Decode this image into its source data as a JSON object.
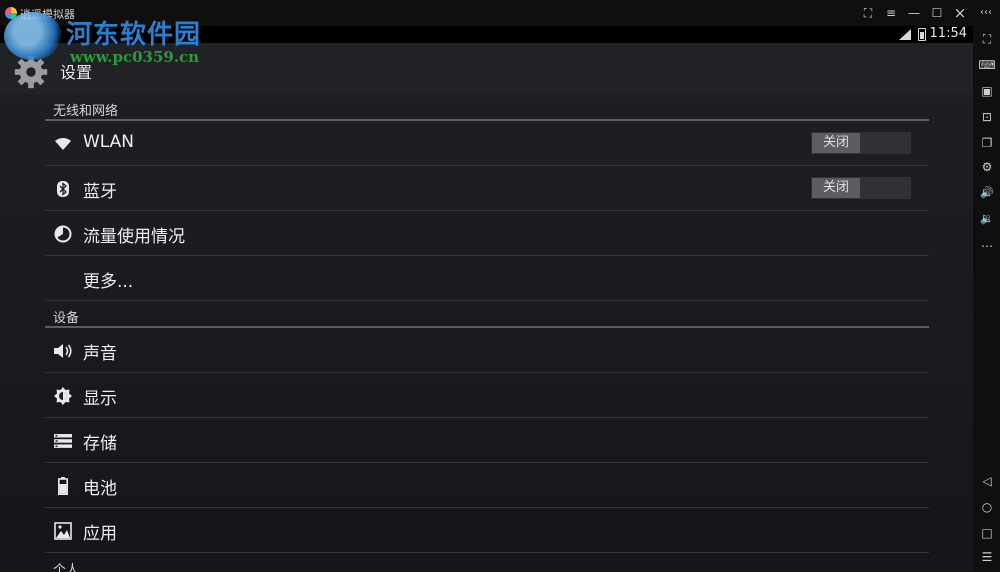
{
  "window": {
    "title": "逍遥模拟器",
    "controls": {
      "expand_icon": "⛶",
      "menu_icon": "≡",
      "minimize": "—",
      "maximize": "☐",
      "close": "×",
      "collapse": "‹‹‹"
    }
  },
  "watermark": {
    "title": "河东软件园",
    "url": "www.pc0359.cn"
  },
  "statusbar": {
    "time": "11:54"
  },
  "actionbar": {
    "title": "设置"
  },
  "settings": {
    "sections": [
      {
        "header": "无线和网络",
        "items": [
          {
            "label": "WLAN",
            "icon": "wifi-icon",
            "toggle": "关闭"
          },
          {
            "label": "蓝牙",
            "icon": "bluetooth-icon",
            "toggle": "关闭"
          },
          {
            "label": "流量使用情况",
            "icon": "data-usage-icon"
          },
          {
            "label": "更多..."
          }
        ]
      },
      {
        "header": "设备",
        "items": [
          {
            "label": "声音",
            "icon": "volume-icon"
          },
          {
            "label": "显示",
            "icon": "brightness-icon"
          },
          {
            "label": "存储",
            "icon": "storage-icon"
          },
          {
            "label": "电池",
            "icon": "battery-icon"
          },
          {
            "label": "应用",
            "icon": "apps-icon"
          }
        ]
      },
      {
        "header": "个人"
      }
    ]
  },
  "toolbar": {
    "items": [
      {
        "name": "fullscreen",
        "glyph": "⛶"
      },
      {
        "name": "keyboard",
        "glyph": "⌨"
      },
      {
        "name": "screenshot",
        "glyph": "▣"
      },
      {
        "name": "screen-record",
        "glyph": "⊡"
      },
      {
        "name": "multi-window",
        "glyph": "❐"
      },
      {
        "name": "settings",
        "glyph": "⚙"
      },
      {
        "name": "volume-up",
        "glyph": "🔊"
      },
      {
        "name": "volume-down",
        "glyph": "🔉"
      },
      {
        "name": "more",
        "glyph": "…"
      },
      {
        "name": "back",
        "glyph": "◁"
      },
      {
        "name": "home",
        "glyph": "○"
      },
      {
        "name": "recents",
        "glyph": "□"
      },
      {
        "name": "menu",
        "glyph": "☰"
      }
    ]
  }
}
